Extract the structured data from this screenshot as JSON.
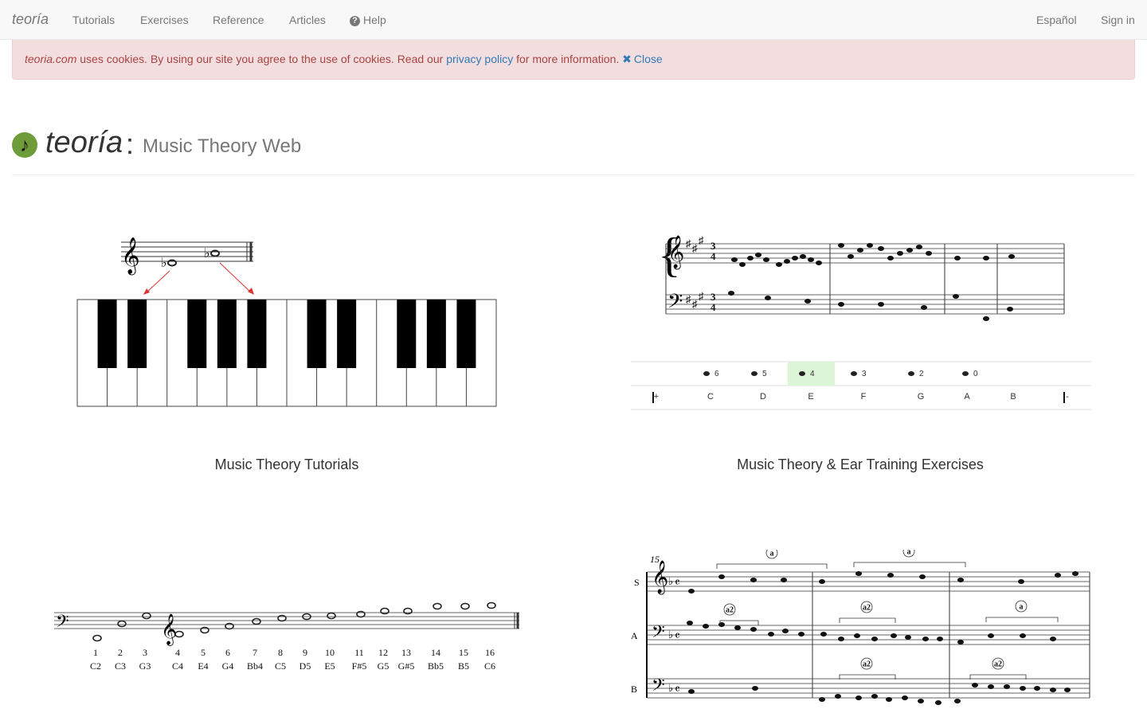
{
  "navbar": {
    "brand": "teoría",
    "items": [
      "Tutorials",
      "Exercises",
      "Reference",
      "Articles"
    ],
    "help": "Help",
    "language": "Español",
    "signin": "Sign in"
  },
  "cookie": {
    "site": "teoria.com",
    "text1": " uses cookies. By using our site you agree to the use of cookies. Read our ",
    "link": "privacy policy",
    "text2": " for more information. ",
    "close": "Close"
  },
  "header": {
    "title": "teoría",
    "separator": ":",
    "subtitle": "Music Theory Web",
    "logo_glyph": "♪"
  },
  "sections": {
    "tutorials": "Music Theory Tutorials",
    "exercises": "Music Theory & Ear Training Exercises"
  },
  "exercise_panel": {
    "durations": [
      "6",
      "5",
      "4",
      "3",
      "2",
      "0"
    ],
    "notes": [
      "+",
      "C",
      "D",
      "E",
      "F",
      "G",
      "A",
      "B",
      "-"
    ]
  },
  "reference_scale": {
    "numbers": [
      "1",
      "2",
      "3",
      "4",
      "5",
      "6",
      "7",
      "8",
      "9",
      "10",
      "11",
      "12",
      "13",
      "14",
      "15",
      "16"
    ],
    "notes": [
      "C2",
      "C3",
      "G3",
      "C4",
      "E4",
      "G4",
      "Bb4",
      "C5",
      "D5",
      "E5",
      "F#5",
      "G5",
      "G#5",
      "Bb5",
      "B5",
      "C6"
    ]
  },
  "score": {
    "measure_number": "15",
    "staff_labels": [
      "S",
      "A",
      "B"
    ],
    "markers": [
      "a",
      "a",
      "a2",
      "a2",
      "a2",
      "a",
      "a2",
      "a2"
    ]
  },
  "colors": {
    "alert_bg": "#f2dede",
    "alert_text": "#a94442",
    "link": "#337ab7",
    "logo": "#6f9c3b",
    "highlight": "#dcf5d6"
  }
}
